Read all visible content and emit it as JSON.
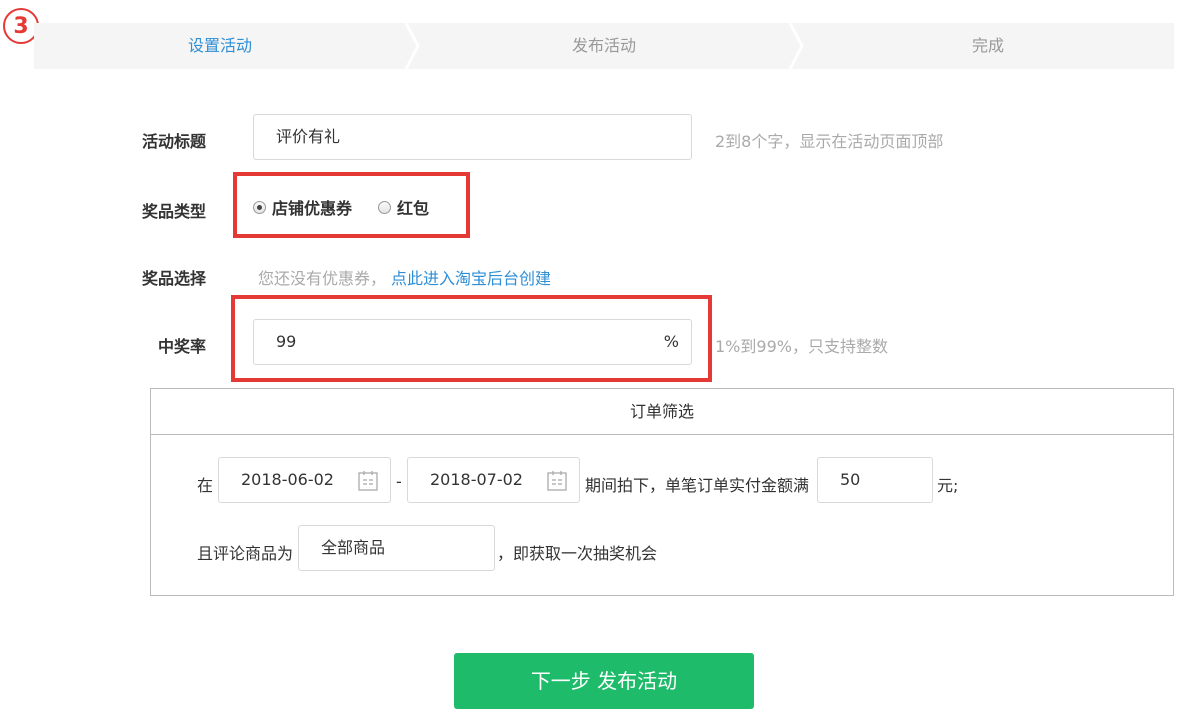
{
  "badge": "3",
  "steps": [
    {
      "label": "设置活动",
      "active": true
    },
    {
      "label": "发布活动",
      "active": false
    },
    {
      "label": "完成",
      "active": false
    }
  ],
  "form": {
    "title": {
      "label": "活动标题",
      "value": "评价有礼",
      "hint": "2到8个字，显示在活动页面顶部"
    },
    "prize_type": {
      "label": "奖品类型",
      "options": [
        "店铺优惠券",
        "红包"
      ],
      "selected": "店铺优惠券"
    },
    "prize_select": {
      "label": "奖品选择",
      "empty_text": "您还没有优惠券，",
      "link": "点此进入淘宝后台创建"
    },
    "win_rate": {
      "label": "中奖率",
      "value": "99",
      "unit": "%",
      "hint": "1%到99%，只支持整数"
    }
  },
  "order_filter": {
    "title": "订单筛选",
    "prefix": "在",
    "start_date": "2018-06-02",
    "separator": "-",
    "end_date": "2018-07-02",
    "middle_text": "期间拍下，单笔订单实付金额满",
    "amount": "50",
    "amount_suffix": "元;",
    "goods_prefix": "且评论商品为",
    "goods_value": "全部商品",
    "goods_suffix": "，即获取一次抽奖机会"
  },
  "next_button": "下一步 发布活动",
  "colors": {
    "accent": "#2e8fd6",
    "highlight": "#e53935",
    "primary_button": "#1dbb6a"
  },
  "icons": {
    "date_picker": "calendar-icon"
  }
}
